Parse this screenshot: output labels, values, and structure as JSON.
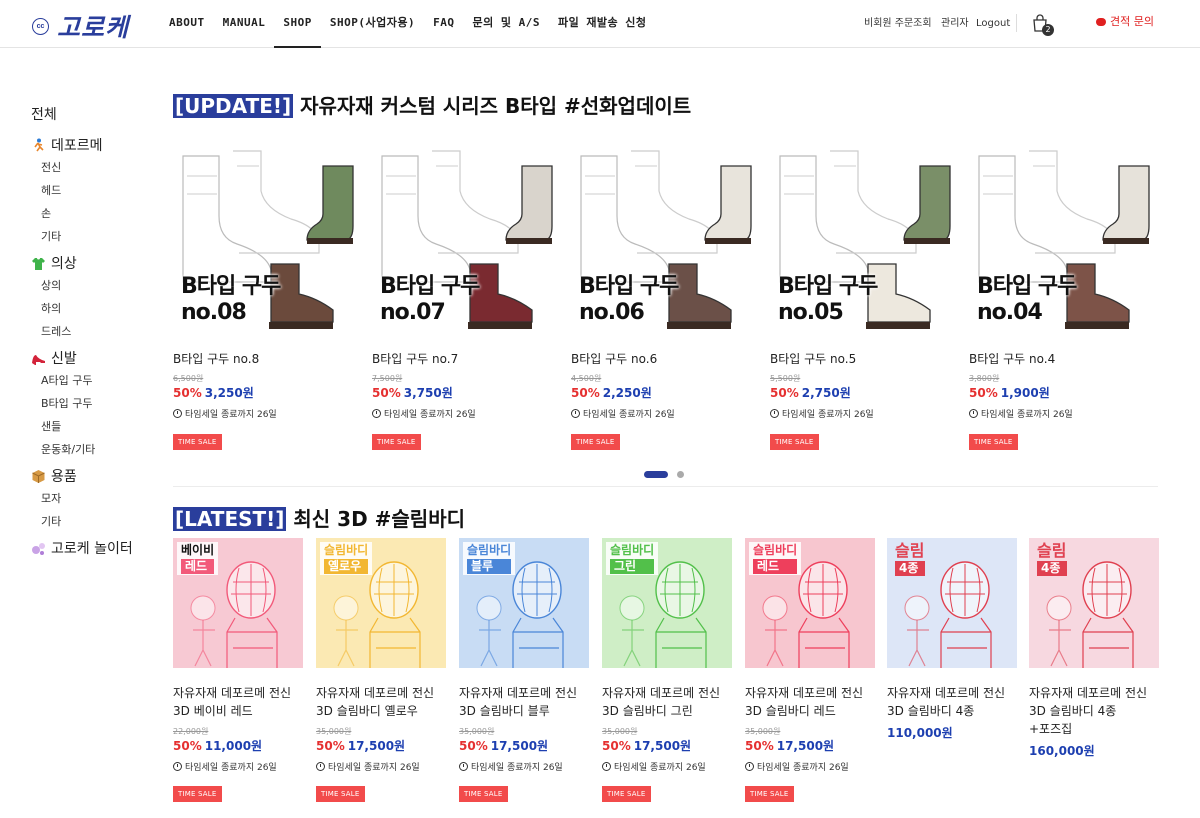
{
  "header": {
    "logo_mark": "cc",
    "logo_text": "고로케",
    "nav": [
      "ABOUT",
      "MANUAL",
      "SHOP",
      "SHOP(사업자용)",
      "FAQ",
      "문의 및 A/S",
      "파일 재발송 신청"
    ],
    "active_nav": "SHOP",
    "guest_order": "비회원 주문조회",
    "admin": "관리자",
    "logout": "Logout",
    "cart_count": "2",
    "quote": "견적 문의"
  },
  "sidebar": {
    "all": "전체",
    "categories": [
      {
        "label": "데포르메",
        "icon": "running-figure-icon",
        "subs": [
          "전신",
          "헤드",
          "손",
          "기타"
        ]
      },
      {
        "label": "의상",
        "icon": "shirt-icon",
        "subs": [
          "상의",
          "하의",
          "드레스"
        ]
      },
      {
        "label": "신발",
        "icon": "high-heel-icon",
        "subs": [
          "A타입 구두",
          "B타입 구두",
          "샌들",
          "운동화/기타"
        ]
      },
      {
        "label": "용품",
        "icon": "package-icon",
        "subs": [
          "모자",
          "기타"
        ]
      },
      {
        "label": "고로케 놀이터",
        "icon": "bubbles-icon",
        "subs": []
      }
    ]
  },
  "update": {
    "tag": "[UPDATE!]",
    "title": " 자유자재 커스텀 시리즈 B타입 #선화업데이트",
    "products": [
      {
        "label1": "B타입 구두",
        "label2": "no.08",
        "name": "B타입 구두 no.8",
        "orig": "6,500원",
        "pct": "50%",
        "price": "3,250원",
        "timer": "타임세일 종료까지 26일",
        "badge": "TIME SALE"
      },
      {
        "label1": "B타입 구두",
        "label2": "no.07",
        "name": "B타입 구두 no.7",
        "orig": "7,500원",
        "pct": "50%",
        "price": "3,750원",
        "timer": "타임세일 종료까지 26일",
        "badge": "TIME SALE"
      },
      {
        "label1": "B타입 구두",
        "label2": "no.06",
        "name": "B타입 구두 no.6",
        "orig": "4,500원",
        "pct": "50%",
        "price": "2,250원",
        "timer": "타임세일 종료까지 26일",
        "badge": "TIME SALE"
      },
      {
        "label1": "B타입 구두",
        "label2": "no.05",
        "name": "B타입 구두 no.5",
        "orig": "5,500원",
        "pct": "50%",
        "price": "2,750원",
        "timer": "타임세일 종료까지 26일",
        "badge": "TIME SALE"
      },
      {
        "label1": "B타입 구두",
        "label2": "no.04",
        "name": "B타입 구두 no.4",
        "orig": "3,800원",
        "pct": "50%",
        "price": "1,900원",
        "timer": "타임세일 종료까지 26일",
        "badge": "TIME SALE"
      }
    ],
    "shoe_colors": [
      [
        "#6f8a5e",
        "#6b4a3c"
      ],
      [
        "#d9d4cc",
        "#7a2a30"
      ],
      [
        "#e8e4dc",
        "#6b5048"
      ],
      [
        "#7a8f68",
        "#ede8de"
      ],
      [
        "#e6e2da",
        "#7d5348"
      ]
    ]
  },
  "latest": {
    "tag": "[LATEST!]",
    "title": " 최신 3D #슬림바디",
    "products": [
      {
        "tag1": "베이비",
        "tag2": "레드",
        "color": "#f25a7a",
        "bg": "#f7c9d3",
        "name1": "자유자재 데포르메 전신",
        "name2": "3D 베이비 레드",
        "orig": "22,000원",
        "pct": "50%",
        "price": "11,000원",
        "timer": "타임세일 종료까지 26일",
        "badge": "TIME SALE"
      },
      {
        "tag1": "슬림바디",
        "tag2": "옐로우",
        "color": "#f2b732",
        "bg": "#fbe9b3",
        "name1": "자유자재 데포르메 전신",
        "name2": "3D 슬림바디 옐로우",
        "orig": "35,000원",
        "pct": "50%",
        "price": "17,500원",
        "timer": "타임세일 종료까지 26일",
        "badge": "TIME SALE"
      },
      {
        "tag1": "슬림바디",
        "tag2": "블루",
        "color": "#4a86d8",
        "bg": "#c8dcf4",
        "name1": "자유자재 데포르메 전신",
        "name2": "3D 슬림바디 블루",
        "orig": "35,000원",
        "pct": "50%",
        "price": "17,500원",
        "timer": "타임세일 종료까지 26일",
        "badge": "TIME SALE"
      },
      {
        "tag1": "슬림바디",
        "tag2": "그린",
        "color": "#52c04a",
        "bg": "#cfeec6",
        "name1": "자유자재 데포르메 전신",
        "name2": "3D 슬림바디 그린",
        "orig": "35,000원",
        "pct": "50%",
        "price": "17,500원",
        "timer": "타임세일 종료까지 26일",
        "badge": "TIME SALE"
      },
      {
        "tag1": "슬림바디",
        "tag2": "레드",
        "color": "#ee3f5c",
        "bg": "#f7c6cf",
        "name1": "자유자재 데포르메 전신",
        "name2": "3D 슬림바디 레드",
        "orig": "35,000원",
        "pct": "50%",
        "price": "17,500원",
        "timer": "타임세일 종료까지 26일",
        "badge": "TIME SALE"
      },
      {
        "tag1": "슬림",
        "tag2": "4종",
        "color": "#e04050",
        "bg": "#dde6f7",
        "name1": "자유자재 데포르메 전신",
        "name2": "3D 슬림바디 4종",
        "orig": "",
        "pct": "",
        "price": "110,000원",
        "timer": "",
        "badge": ""
      },
      {
        "tag1": "슬림",
        "tag2": "4종",
        "color": "#e04050",
        "bg": "#f7d8e0",
        "name1": "자유자재 데포르메 전신",
        "name2": "3D 슬림바디 4종",
        "name3": "+포즈집",
        "orig": "",
        "pct": "",
        "price": "160,000원",
        "timer": "",
        "badge": ""
      }
    ]
  }
}
